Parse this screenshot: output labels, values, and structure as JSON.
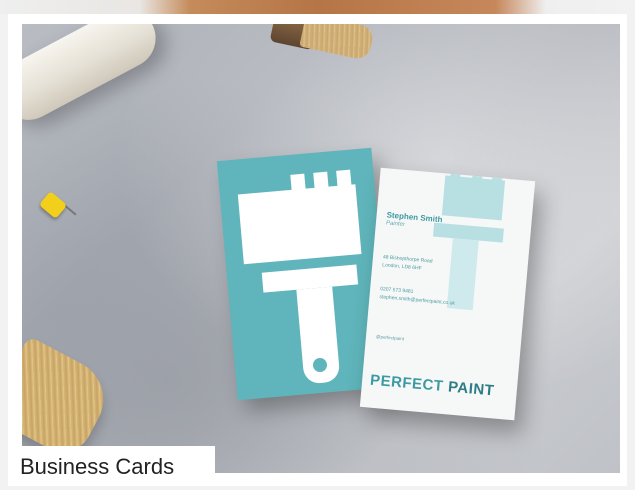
{
  "caption": "Business Cards",
  "photo": {
    "card_back": {
      "name": "Stephen Smith",
      "role": "Painter",
      "address_line1": "48 Bishopthorpe Road",
      "address_line2": "London, LD8 6HF",
      "phone": "0207 573 9481",
      "email": "stephen.smith@perfectpaint.co.uk",
      "social_handle": "@perfectpaint",
      "brand_word1": "PERFECT",
      "brand_word2": "PAINT"
    }
  },
  "colors": {
    "teal": "#5fb5bb",
    "label_bg": "#ffffff",
    "label_text": "#222222"
  }
}
